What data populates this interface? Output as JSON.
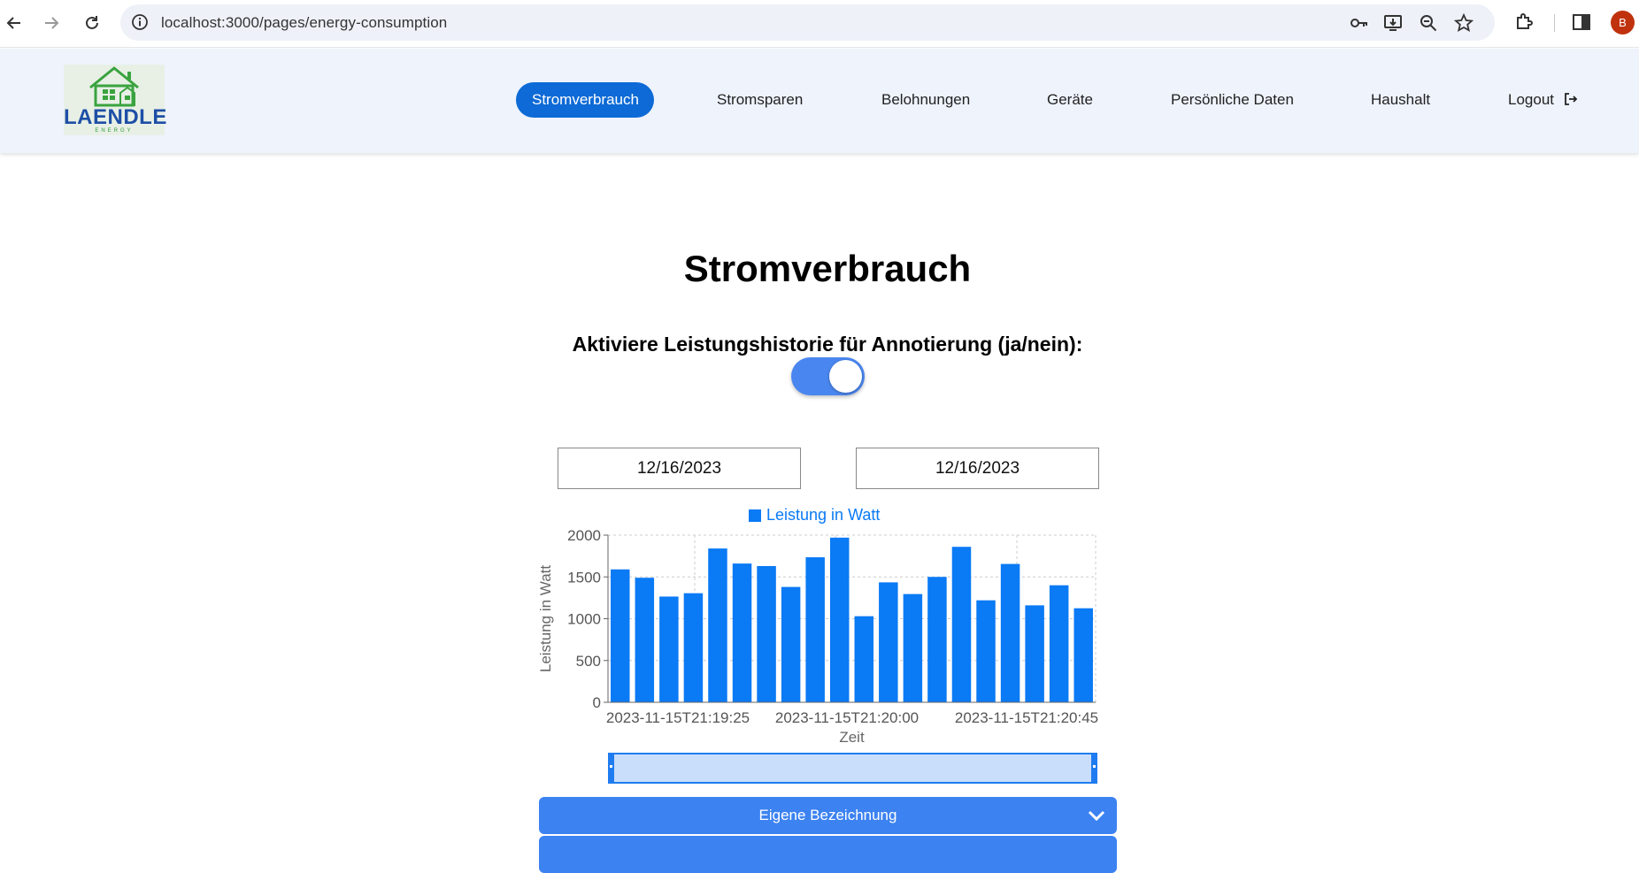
{
  "browser": {
    "url": "localhost:3000/pages/energy-consumption",
    "profile_initial": "B"
  },
  "header": {
    "logo_text": "LAENDLE",
    "logo_subtext": "ENERGY",
    "menu": [
      {
        "label": "Stromverbrauch",
        "active": true
      },
      {
        "label": "Stromsparen",
        "active": false
      },
      {
        "label": "Belohnungen",
        "active": false
      },
      {
        "label": "Geräte",
        "active": false
      },
      {
        "label": "Persönliche Daten",
        "active": false
      },
      {
        "label": "Haushalt",
        "active": false
      },
      {
        "label": "Logout",
        "active": false
      }
    ]
  },
  "main": {
    "title": "Stromverbrauch",
    "toggle_label": "Aktiviere Leistungshistorie für Annotierung (ja/nein):",
    "toggle_on": true,
    "date_from": "12/16/2023",
    "date_to": "12/16/2023",
    "accordion_1": "Eigene Bezeichnung"
  },
  "colors": {
    "accent": "#0d6ad6",
    "bar": "#0a7af5",
    "header_bg": "#eef3fc"
  },
  "chart_data": {
    "type": "bar",
    "legend": "Leistung in Watt",
    "xlabel": "Zeit",
    "ylabel": "Leistung in Watt",
    "ylim": [
      0,
      2000
    ],
    "yticks": [
      0,
      500,
      1000,
      1500,
      2000
    ],
    "x_tick_labels": [
      "2023-11-15T21:19:25",
      "2023-11-15T21:20:00",
      "2023-11-15T21:20:45"
    ],
    "values": [
      1590,
      1490,
      1265,
      1305,
      1840,
      1660,
      1630,
      1380,
      1735,
      1970,
      1030,
      1435,
      1295,
      1500,
      1860,
      1220,
      1655,
      1160,
      1400,
      1125
    ],
    "grid": true
  }
}
